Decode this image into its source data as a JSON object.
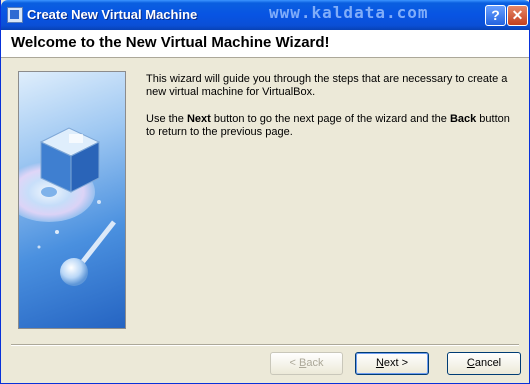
{
  "window": {
    "title": "Create New Virtual Machine",
    "watermark": "www.kaldata.com",
    "help_label": "?",
    "close_label": "✕"
  },
  "header": {
    "title": "Welcome to the New Virtual Machine Wizard!"
  },
  "content": {
    "p1": "This wizard will guide you through the steps that are necessary to create a new virtual machine for VirtualBox.",
    "p2_before": "Use the ",
    "p2_next": "Next",
    "p2_mid": " button to go the next page of the wizard and the ",
    "p2_back": "Back",
    "p2_after": " button to return to the previous page."
  },
  "buttons": {
    "back_arrow": "< ",
    "back_key": "B",
    "back_rest": "ack",
    "next_key": "N",
    "next_rest": "ext >",
    "cancel_key": "C",
    "cancel_rest": "ancel"
  },
  "colors": {
    "titlebar": "#0854e3",
    "panel": "#4a90df",
    "face": "#ece9d8"
  }
}
